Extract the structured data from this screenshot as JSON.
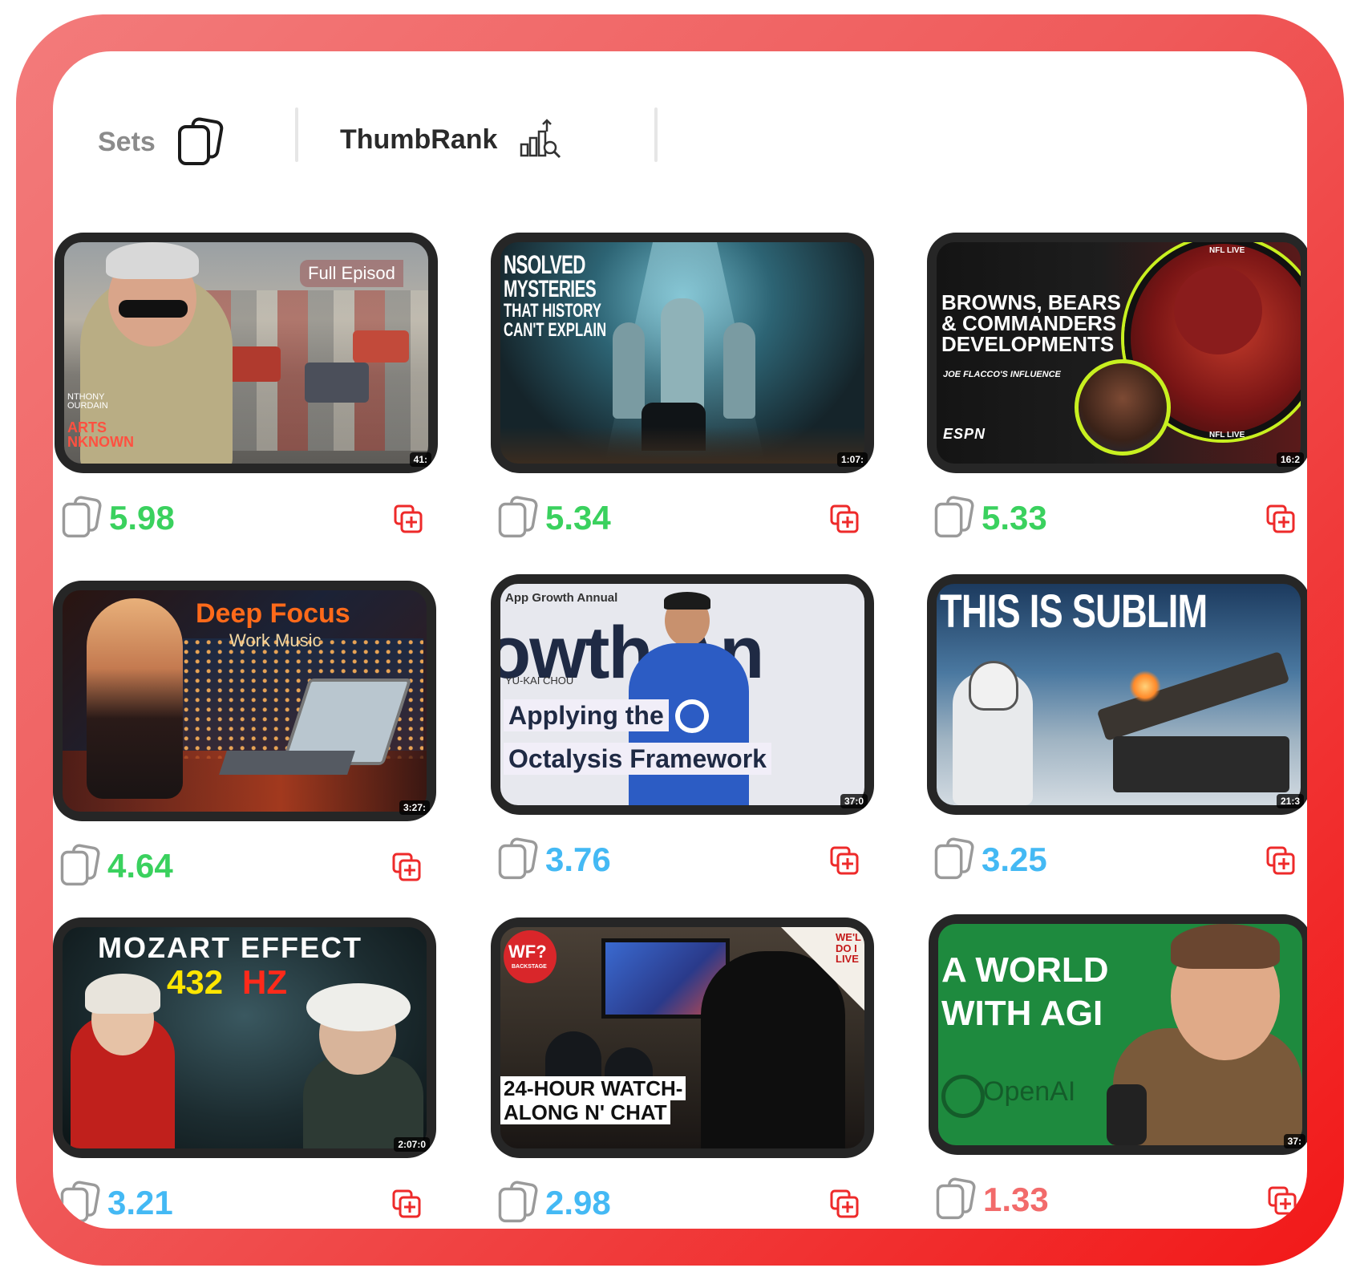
{
  "header": {
    "tabs": [
      {
        "label": "Sets",
        "icon": "stack-icon",
        "active": false
      },
      {
        "label": "ThumbRank",
        "icon": "chart-magnifier-icon",
        "active": true
      }
    ]
  },
  "colors": {
    "frame": "#ef4b4b",
    "score_green": "#3ad15e",
    "score_blue": "#44b9f4",
    "score_red": "#f26b6b",
    "add_icon": "#ee2a2a"
  },
  "cards": [
    {
      "score": "5.98",
      "score_color": "green",
      "duration": "41:",
      "texts": {
        "badge": "Full Episod",
        "show": "NTHONY OURDAIN",
        "show2": "ARTS NKNOWN"
      }
    },
    {
      "score": "5.34",
      "score_color": "green",
      "duration": "1:07:",
      "texts": {
        "l1": "NSOLVED",
        "l2": "MYSTERIES",
        "l3": "THAT HISTORY",
        "l4": "CAN'T EXPLAIN"
      }
    },
    {
      "score": "5.33",
      "score_color": "green",
      "duration": "16:2",
      "texts": {
        "l1": "BROWNS, BEARS",
        "l2": "& COMMANDERS",
        "l3": "DEVELOPMENTS",
        "sub": "JOE FLACCO'S INFLUENCE",
        "brand": "ESPN",
        "ring": "NFL LIVE",
        "ring2": "NFL LIVE"
      }
    },
    {
      "score": "4.64",
      "score_color": "green",
      "duration": "3:27:",
      "texts": {
        "l1": "Deep Focus",
        "l2": "Work Music"
      }
    },
    {
      "score": "3.76",
      "score_color": "blue",
      "duration": "37:0",
      "texts": {
        "top": "App Growth Annual",
        "big": "owth An",
        "name": "YU-KAI CHOU",
        "l1": "Applying the",
        "l2": "Octalysis Framework"
      }
    },
    {
      "score": "3.25",
      "score_color": "blue",
      "duration": "21:3",
      "texts": {
        "l1": "THIS IS SUBLIM"
      }
    },
    {
      "score": "3.21",
      "score_color": "blue",
      "duration": "2:07:0",
      "texts": {
        "l1": "MOZART EFFECT",
        "l2a": "432",
        "l2b": "HZ"
      }
    },
    {
      "score": "2.98",
      "score_color": "blue",
      "duration": "",
      "texts": {
        "badge": "WF?",
        "badge_sub": "BACKSTAGE",
        "corner": "WE'L DO I LIVE",
        "l1": "24-HOUR WATCH-",
        "l2": "ALONG N' CHAT"
      }
    },
    {
      "score": "1.33",
      "score_color": "red",
      "duration": "37:",
      "texts": {
        "l1": "A WORLD",
        "l2": "WITH AGI",
        "brand": "OpenAI"
      }
    }
  ]
}
